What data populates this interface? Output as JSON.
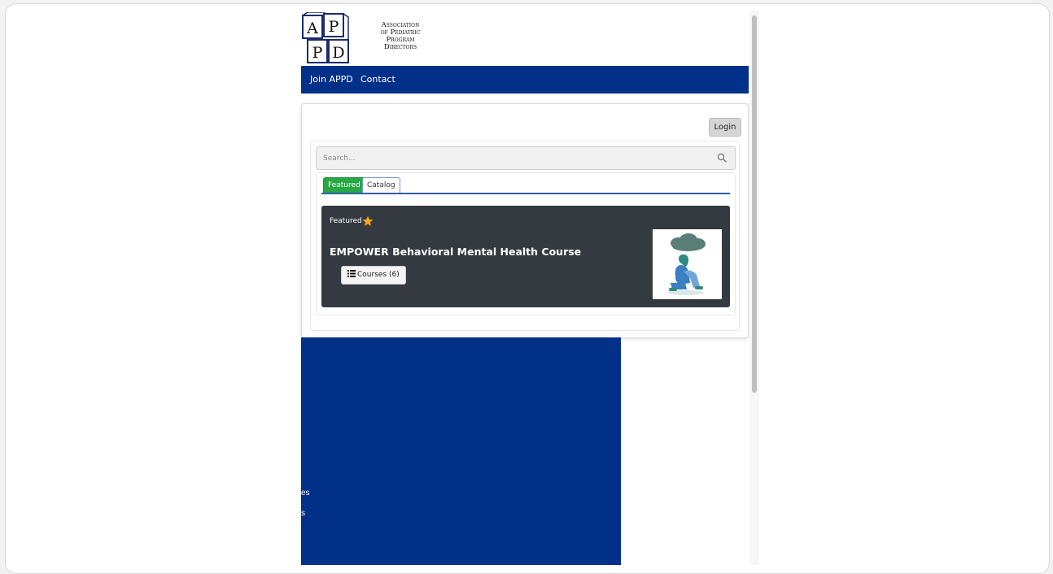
{
  "logo": {
    "lines": [
      "Association",
      "of Pediatric",
      "Program",
      "Directors"
    ],
    "letters": [
      "A",
      "P",
      "P",
      "D"
    ],
    "alt": "Association of Pediatric Program Directors"
  },
  "nav": {
    "items": [
      {
        "label": "Join APPD"
      },
      {
        "label": "Contact"
      }
    ]
  },
  "header": {
    "login_label": "Login"
  },
  "search": {
    "placeholder": "Search...",
    "value": "",
    "icon": "search-icon"
  },
  "tabs": [
    {
      "label": "Featured",
      "active": true
    },
    {
      "label": "Catalog",
      "active": false
    }
  ],
  "featured": {
    "label": "Featured",
    "icon": "star-icon",
    "title": "EMPOWER Behavioral Mental Health Course",
    "courses_label": "Courses (6)",
    "courses_icon": "list-icon",
    "image_subject": "person-under-rain-cloud"
  },
  "background_fragments": [
    "es",
    "s"
  ],
  "colors": {
    "brand_blue": "#003087",
    "tab_active": "#28a745",
    "card_dark": "#343a40",
    "star": "#f5a623"
  }
}
